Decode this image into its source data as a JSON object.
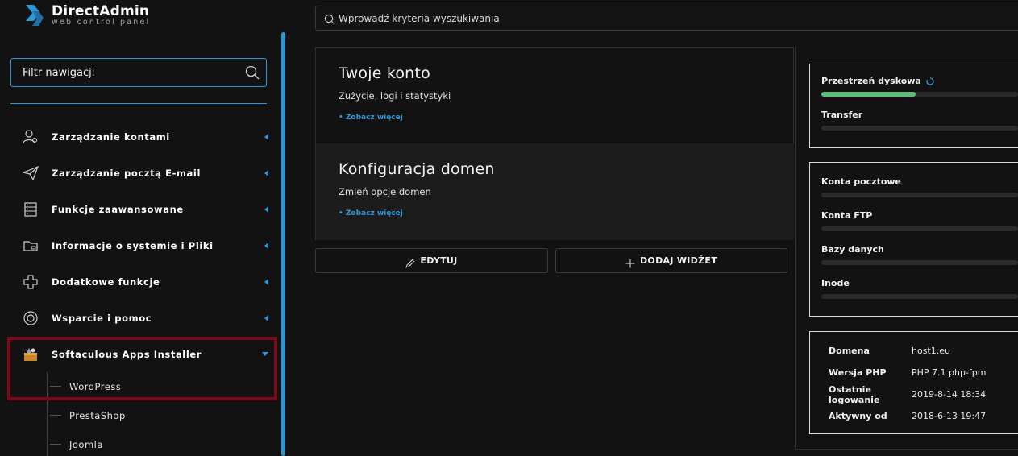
{
  "app": {
    "logo_name": "DirectAdmin",
    "logo_tagline": "web control panel"
  },
  "sidebar": {
    "filter_placeholder": "Filtr nawigacji",
    "items": [
      {
        "label": "Zarządzanie kontami",
        "icon": "user-settings-icon"
      },
      {
        "label": "Zarządzanie pocztą E-mail",
        "icon": "paper-plane-icon"
      },
      {
        "label": "Funkcje zaawansowane",
        "icon": "server-icon"
      },
      {
        "label": "Informacje o systemie i Pliki",
        "icon": "folder-icon"
      },
      {
        "label": "Dodatkowe funkcje",
        "icon": "plus-outline-icon"
      },
      {
        "label": "Wsparcie i pomoc",
        "icon": "lifebuoy-icon"
      },
      {
        "label": "Softaculous Apps Installer",
        "icon": "softaculous-icon"
      }
    ],
    "softaculous_sub": [
      "WordPress",
      "PrestaShop",
      "Joomla"
    ]
  },
  "search": {
    "placeholder": "Wprowadź kryteria wyszukiwania"
  },
  "widgets": [
    {
      "title": "Twoje konto",
      "description": "Zużycie, logi i statystyki",
      "link": "• Zobacz więcej"
    },
    {
      "title": "Konfiguracja domen",
      "description": "Zmień opcje domen",
      "link": "• Zobacz więcej"
    }
  ],
  "buttons": {
    "edit_label": "EDYTUJ",
    "add_widget_label": "DODAJ WIDŻET"
  },
  "usage": {
    "disk_label": "Przestrzeń dyskowa",
    "disk_fraction": 0.48,
    "transfer_label": "Transfer",
    "transfer_fraction": 0
  },
  "counts": {
    "mail_accounts": "Konta pocztowe",
    "ftp_accounts": "Konta FTP",
    "databases": "Bazy danych",
    "inodes": "Inode"
  },
  "info": [
    {
      "key": "Domena",
      "value": "host1.eu"
    },
    {
      "key": "Wersja PHP",
      "value": "PHP 7.1 php-fpm"
    },
    {
      "key": "Ostatnie logowanie",
      "value": "2019-8-14 18:34"
    },
    {
      "key": "Aktywny od",
      "value": "2018-6-13 19:47"
    }
  ],
  "colors": {
    "accent": "#2b97d6",
    "highlight": "#7a0a1a",
    "disk_fill": "#5fbf7a"
  }
}
